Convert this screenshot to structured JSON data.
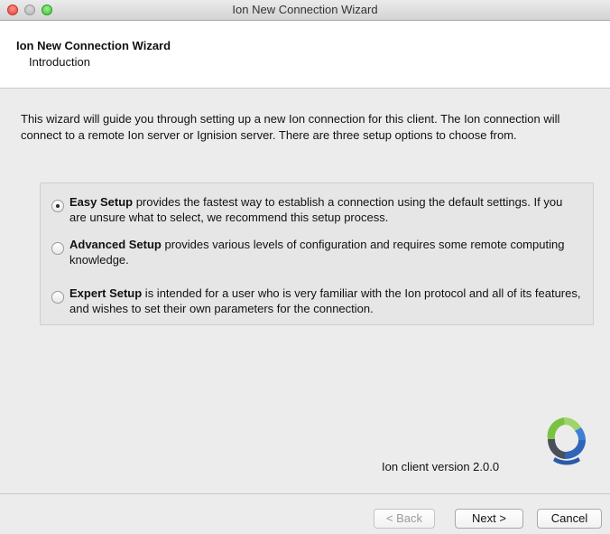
{
  "window": {
    "title": "Ion New Connection Wizard"
  },
  "header": {
    "title": "Ion New Connection Wizard",
    "subtitle": "Introduction"
  },
  "intro": "This wizard will guide you through setting up a new Ion connection for this client. The Ion connection will connect to a remote Ion server or Ignision server. There are three setup options to choose from.",
  "options": [
    {
      "name": "Easy Setup",
      "description": " provides the fastest way to establish a connection using the default settings. If you are unsure what to select, we recommend this setup process.",
      "selected": true
    },
    {
      "name": "Advanced Setup",
      "description": " provides various levels of configuration and requires some remote computing knowledge.",
      "selected": false
    },
    {
      "name": "Expert Setup",
      "description": " is intended for a user who is very familiar with the Ion protocol and all of its features, and wishes to set their own parameters for the connection.",
      "selected": false
    }
  ],
  "version_text": "Ion client version 2.0.0",
  "buttons": {
    "back": "< Back",
    "next": "Next >",
    "cancel": "Cancel"
  },
  "colors": {
    "logo_green": "#7cc242",
    "logo_blue": "#2f64b8",
    "logo_dark": "#4a4f5a"
  },
  "icons": {
    "logo": "ion-logo-icon"
  }
}
